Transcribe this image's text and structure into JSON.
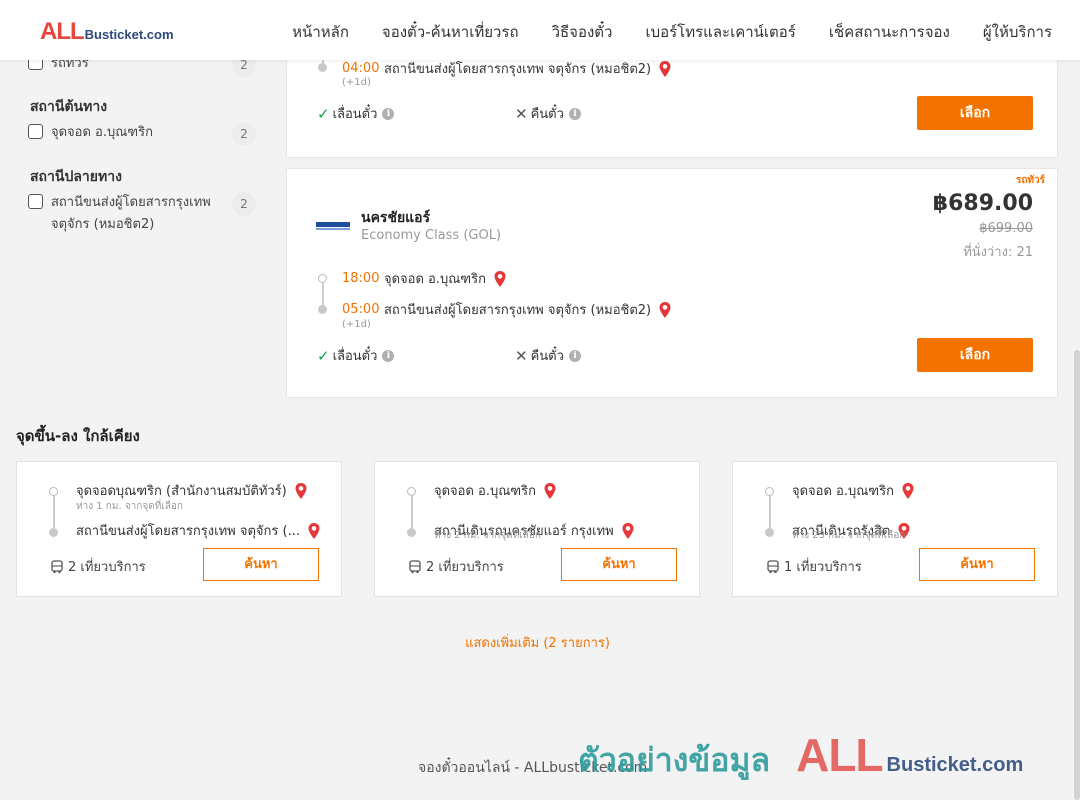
{
  "header": {
    "logo_all": "ALL",
    "logo_bus": "Busticket.com",
    "nav": [
      "หน้าหลัก",
      "จองตั๋ว-ค้นหาเที่ยวรถ",
      "วิธีจองตั๋ว",
      "เบอร์โทรและเคาน์เตอร์",
      "เช็คสถานะการจอง",
      "ผู้ให้บริการ"
    ]
  },
  "sidebar": {
    "top_item": {
      "label": "รถทัวร์",
      "count": "2"
    },
    "origin_title": "สถานีต้นทาง",
    "origin_item": {
      "label": "จุดจอด อ.บุณฑริก",
      "count": "2"
    },
    "dest_title": "สถานีปลายทาง",
    "dest_item": {
      "label": "สถานีขนส่งผู้โดยสารกรุงเทพ จตุจักร (หมอชิต2)",
      "count": "2"
    }
  },
  "trip1": {
    "arr_time": "04:00",
    "arr_station": "สถานีขนส่งผู้โดยสารกรุงเทพ จตุจักร (หมอชิต2)",
    "plus_day": "(+1d)",
    "reschedule": "เลื่อนตั๋ว",
    "refund": "คืนตั๋ว",
    "select_label": "เลือก"
  },
  "trip2": {
    "tag": "รถทัวร์",
    "operator": "นครชัยแอร์",
    "class": "Economy Class (GOL)",
    "price": "฿689.00",
    "price_old": "฿699.00",
    "seats": "ที่นั่งว่าง: 21",
    "dep_time": "18:00",
    "dep_station": "จุดจอด อ.บุณฑริก",
    "arr_time": "05:00",
    "arr_station": "สถานีขนส่งผู้โดยสารกรุงเทพ จตุจักร (หมอชิต2)",
    "plus_day": "(+1d)",
    "reschedule": "เลื่อนตั๋ว",
    "refund": "คืนตั๋ว",
    "select_label": "เลือก"
  },
  "nearby": {
    "title": "จุดขึ้น-ลง ใกล้เคียง",
    "cards": [
      {
        "from": "จุดจอดบุณฑริก (สำนักงานสมบัติทัวร์)",
        "from_dist": "ห่าง 1 กม. จากจุดที่เลือก",
        "to": "สถานีขนส่งผู้โดยสารกรุงเทพ จตุจักร (...",
        "to_dist": "",
        "trips": "2 เที่ยวบริการ",
        "button": "ค้นหา"
      },
      {
        "from": "จุดจอด อ.บุณฑริก",
        "from_dist": "",
        "to": "สถานีเดินรถนครชัยแอร์ กรุงเทพ",
        "to_dist": "ห่าง 2 กม. จากจุดที่เลือก",
        "trips": "2 เที่ยวบริการ",
        "button": "ค้นหา"
      },
      {
        "from": "จุดจอด อ.บุณฑริก",
        "from_dist": "",
        "to": "สถานีเดินรถรังสิต",
        "to_dist": "ห่าง 23 กม. จากจุดที่เลือก",
        "trips": "1 เที่ยวบริการ",
        "button": "ค้นหา"
      }
    ],
    "more": "แสดงเพิ่มเติม (2 รายการ)"
  },
  "footer": {
    "text": "จองตั๋วออนไลน์ - ALLbusticket.com"
  },
  "watermark": {
    "thai": "ตัวอย่างข้อมูล",
    "all": "ALL",
    "bus": "Busticket.com"
  },
  "colors": {
    "accent": "#f47200",
    "brand_red": "#e8453c",
    "brand_navy": "#2c4a7c"
  }
}
